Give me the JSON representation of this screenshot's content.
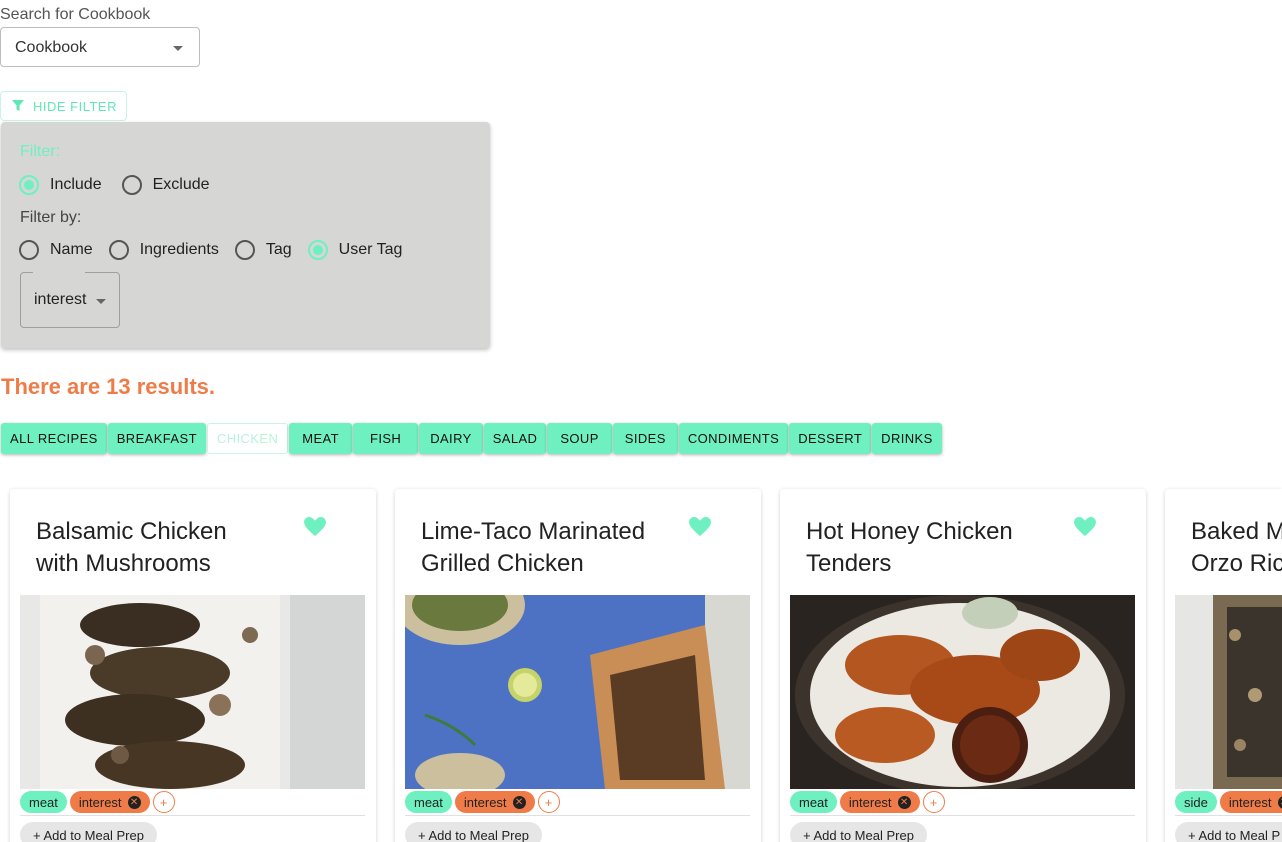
{
  "search": {
    "label": "Search for Cookbook",
    "selected": "Cookbook"
  },
  "filter_toggle": {
    "label": "HIDE FILTER",
    "icon": "filter-icon"
  },
  "filter": {
    "title": "Filter:",
    "mode_options": [
      {
        "label": "Include",
        "checked": true
      },
      {
        "label": "Exclude",
        "checked": false
      }
    ],
    "filter_by_label": "Filter by:",
    "by_options": [
      {
        "label": "Name",
        "checked": false
      },
      {
        "label": "Ingredients",
        "checked": false
      },
      {
        "label": "Tag",
        "checked": false
      },
      {
        "label": "User Tag",
        "checked": true
      }
    ],
    "tag_value": "interest"
  },
  "results_text": "There are 13 results.",
  "categories": [
    {
      "label": "ALL RECIPES",
      "active": false
    },
    {
      "label": "BREAKFAST",
      "active": false
    },
    {
      "label": "CHICKEN",
      "active": true
    },
    {
      "label": "MEAT",
      "active": false
    },
    {
      "label": "FISH",
      "active": false
    },
    {
      "label": "DAIRY",
      "active": false
    },
    {
      "label": "SALAD",
      "active": false
    },
    {
      "label": "SOUP",
      "active": false
    },
    {
      "label": "SIDES",
      "active": false
    },
    {
      "label": "CONDIMENTS",
      "active": false
    },
    {
      "label": "DESSERT",
      "active": false
    },
    {
      "label": "DRINKS",
      "active": false
    }
  ],
  "recipes": [
    {
      "title": "Balsamic Chicken with Mushrooms",
      "favorite": true,
      "tags": [
        {
          "label": "meat",
          "color": "green"
        },
        {
          "label": "interest",
          "color": "orange",
          "removable": true
        }
      ],
      "add_tag": "+",
      "meal_prep": "+ Add to Meal Prep"
    },
    {
      "title": "Lime-Taco Marinated Grilled Chicken",
      "favorite": true,
      "tags": [
        {
          "label": "meat",
          "color": "green"
        },
        {
          "label": "interest",
          "color": "orange",
          "removable": true
        }
      ],
      "add_tag": "+",
      "meal_prep": "+ Add to Meal Prep"
    },
    {
      "title": "Hot Honey Chicken Tenders",
      "favorite": true,
      "tags": [
        {
          "label": "meat",
          "color": "green"
        },
        {
          "label": "interest",
          "color": "orange",
          "removable": true
        }
      ],
      "add_tag": "+",
      "meal_prep": "+ Add to Meal Prep"
    },
    {
      "title": "Baked M Orzo Ric",
      "favorite": false,
      "tags": [
        {
          "label": "side",
          "color": "green"
        },
        {
          "label": "interest",
          "color": "orange",
          "removable": true
        }
      ],
      "add_tag": "+",
      "meal_prep": "+ Add to Meal P"
    }
  ],
  "colors": {
    "accent": "#6ef0c0",
    "highlight": "#ef7c48",
    "panel": "#d6d7d4"
  }
}
